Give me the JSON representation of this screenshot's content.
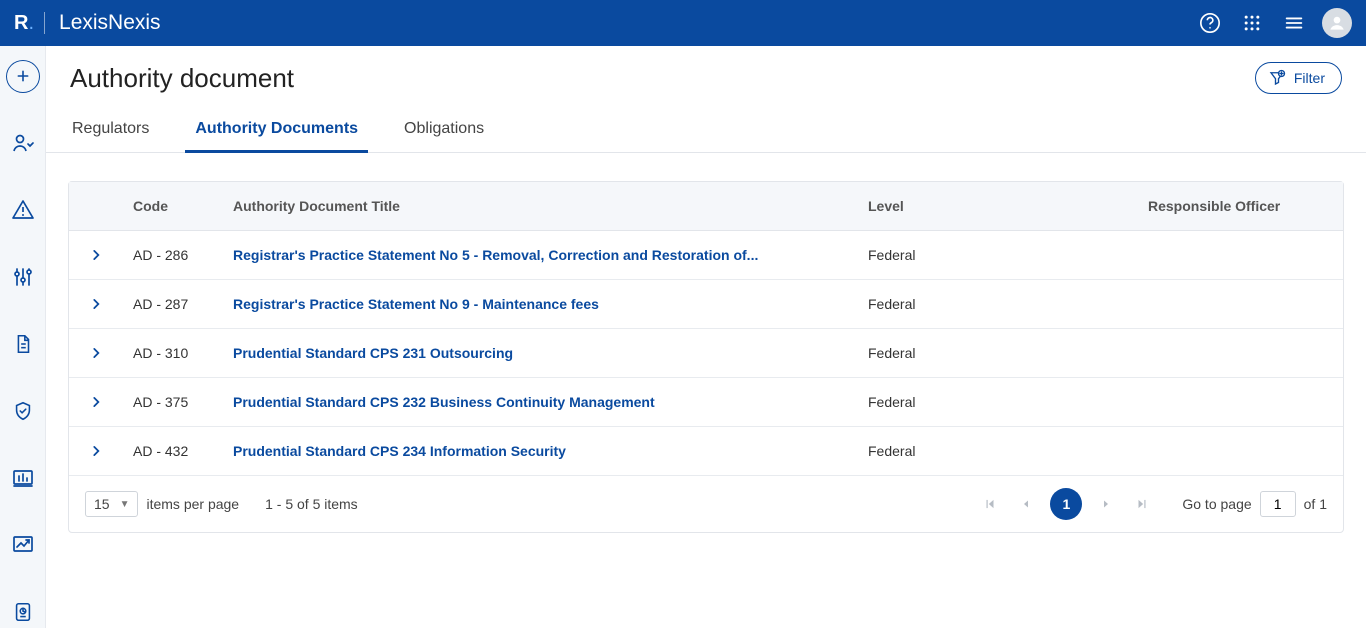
{
  "brand": {
    "logo": "R",
    "name": "LexisNexis"
  },
  "page": {
    "title": "Authority document",
    "filter_label": "Filter"
  },
  "tabs": [
    {
      "label": "Regulators",
      "active": false
    },
    {
      "label": "Authority Documents",
      "active": true
    },
    {
      "label": "Obligations",
      "active": false
    }
  ],
  "table": {
    "columns": {
      "code": "Code",
      "title": "Authority Document Title",
      "level": "Level",
      "officer": "Responsible Officer"
    },
    "rows": [
      {
        "code": "AD - 286",
        "title": "Registrar's Practice Statement No 5 - Removal, Correction and Restoration of...",
        "level": "Federal",
        "officer": ""
      },
      {
        "code": "AD - 287",
        "title": "Registrar's Practice Statement No 9 - Maintenance fees",
        "level": "Federal",
        "officer": ""
      },
      {
        "code": "AD - 310",
        "title": "Prudential Standard CPS 231 Outsourcing",
        "level": "Federal",
        "officer": ""
      },
      {
        "code": "AD - 375",
        "title": "Prudential Standard CPS 232 Business Continuity Management",
        "level": "Federal",
        "officer": ""
      },
      {
        "code": "AD - 432",
        "title": "Prudential Standard CPS 234 Information Security",
        "level": "Federal",
        "officer": ""
      }
    ]
  },
  "pager": {
    "page_size": "15",
    "items_per_page_label": "items per page",
    "range_label": "1 - 5 of 5 items",
    "current_page": "1",
    "goto_label": "Go to page",
    "goto_value": "1",
    "of_label": "of 1"
  }
}
